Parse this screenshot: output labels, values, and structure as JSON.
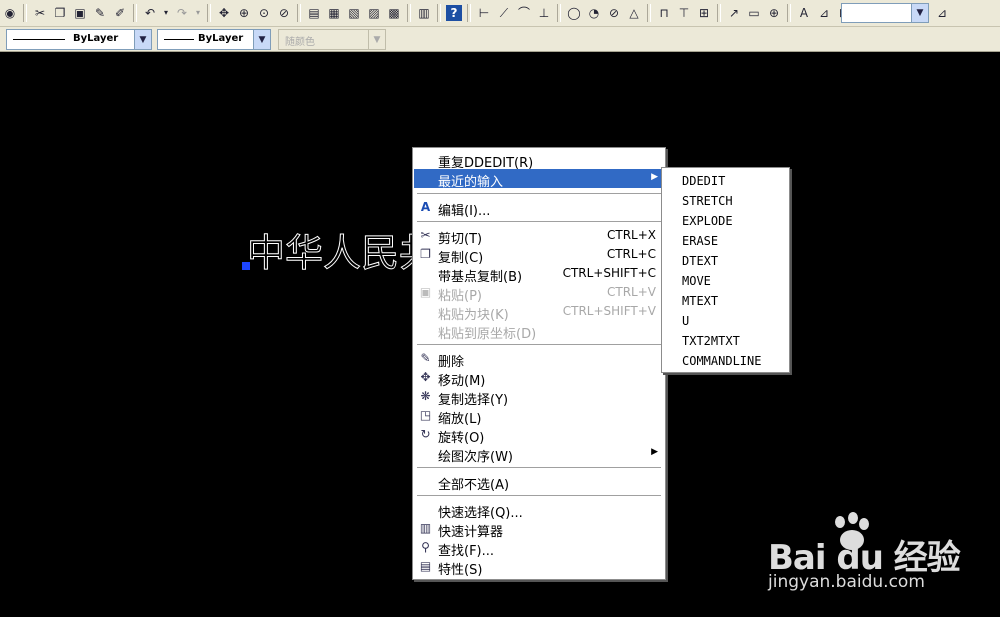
{
  "layer_combo": {
    "text": "ByLayer"
  },
  "linetype_combo": {
    "text": "ByLayer"
  },
  "color_combo": {
    "text": "随颜色"
  },
  "drawing": {
    "text": "中华人民共和"
  },
  "context_menu": {
    "repeat": "重复DDEDIT(R)",
    "recent": "最近的输入",
    "edit": "编辑(I)...",
    "cut": "剪切(T)",
    "cut_sc": "CTRL+X",
    "copy": "复制(C)",
    "copy_sc": "CTRL+C",
    "copy_base": "带基点复制(B)",
    "copy_base_sc": "CTRL+SHIFT+C",
    "paste": "粘贴(P)",
    "paste_sc": "CTRL+V",
    "paste_block": "粘贴为块(K)",
    "paste_block_sc": "CTRL+SHIFT+V",
    "paste_orig": "粘贴到原坐标(D)",
    "erase": "删除",
    "move": "移动(M)",
    "copy_sel": "复制选择(Y)",
    "scale": "缩放(L)",
    "rotate": "旋转(O)",
    "draworder": "绘图次序(W)",
    "deselect": "全部不选(A)",
    "qselect": "快速选择(Q)...",
    "qcalc": "快速计算器",
    "find": "查找(F)...",
    "props": "特性(S)"
  },
  "submenu": {
    "items": [
      "DDEDIT",
      "STRETCH",
      "EXPLODE",
      "ERASE",
      "DTEXT",
      "MOVE",
      "MTEXT",
      "U",
      "TXT2MTXT",
      "COMMANDLINE"
    ]
  },
  "watermark": {
    "brand": "Bai du 经验",
    "url": "jingyan.baidu.com"
  }
}
